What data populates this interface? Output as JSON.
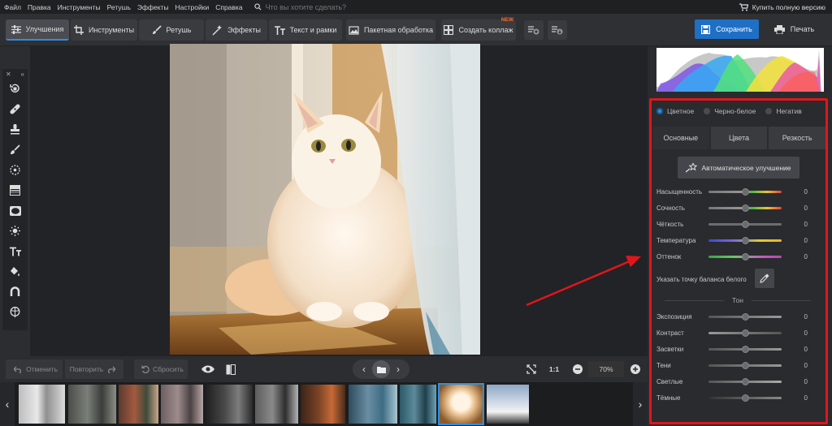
{
  "menu": {
    "items": [
      "Файл",
      "Правка",
      "Инструменты",
      "Ретушь",
      "Эффекты",
      "Настройки",
      "Справка"
    ],
    "search_placeholder": "Что вы хотите сделать?",
    "buy_label": "Купить полную версию"
  },
  "tabs": [
    {
      "label": "Улучшения",
      "icon": "sliders-icon"
    },
    {
      "label": "Инструменты",
      "icon": "crop-icon"
    },
    {
      "label": "Ретушь",
      "icon": "brush-icon"
    },
    {
      "label": "Эффекты",
      "icon": "sparkle-icon"
    },
    {
      "label": "Текст и рамки",
      "icon": "text-icon"
    },
    {
      "label": "Пакетная обработка",
      "icon": "image-stack-icon"
    },
    {
      "label": "Создать коллаж",
      "icon": "collage-icon",
      "badge": "NEW"
    }
  ],
  "actions": {
    "save": "Сохранить",
    "print": "Печать"
  },
  "bottom": {
    "undo": "Отменить",
    "redo": "Повторить",
    "reset": "Сбросить",
    "zoom_ratio": "1:1",
    "zoom_value": "70%"
  },
  "panel": {
    "modes": [
      {
        "label": "Цветное",
        "selected": true
      },
      {
        "label": "Черно-белое",
        "selected": false
      },
      {
        "label": "Негатив",
        "selected": false
      }
    ],
    "subtabs": [
      "Основные",
      "Цвета",
      "Резкость"
    ],
    "auto_label": "Автоматическое улучшение",
    "sliders": [
      {
        "label": "Насыщенность",
        "value": "0"
      },
      {
        "label": "Сочность",
        "value": "0"
      },
      {
        "label": "Чёткость",
        "value": "0"
      },
      {
        "label": "Температура",
        "value": "0"
      },
      {
        "label": "Оттенок",
        "value": "0"
      }
    ],
    "white_balance_label": "Указать точку баланса белого",
    "tone_section": "Тон",
    "tone_sliders": [
      {
        "label": "Экспозиция",
        "value": "0"
      },
      {
        "label": "Контраст",
        "value": "0"
      },
      {
        "label": "Засветки",
        "value": "0"
      },
      {
        "label": "Тени",
        "value": "0"
      },
      {
        "label": "Светлые",
        "value": "0"
      },
      {
        "label": "Тёмные",
        "value": "0"
      }
    ]
  },
  "colors": {
    "accent": "#2e8fe0",
    "highlight_box": "#e0161b",
    "save_button": "#1f6fc5",
    "badge": "#ff6b2b"
  }
}
